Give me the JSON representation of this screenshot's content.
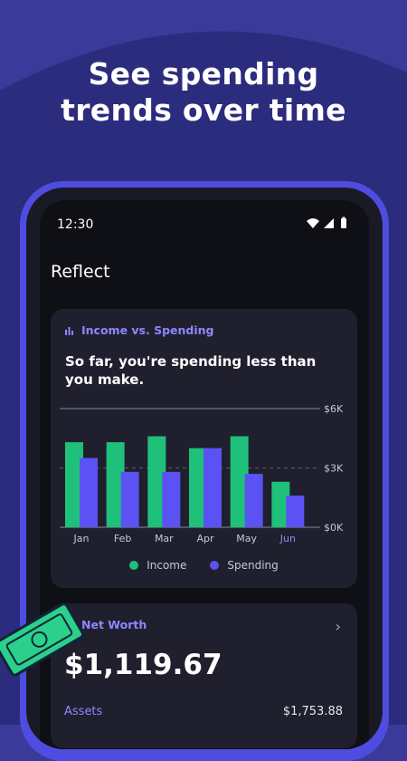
{
  "promo": {
    "headline_line1": "See spending",
    "headline_line2": "trends over time"
  },
  "status_bar": {
    "time": "12:30"
  },
  "app": {
    "title": "Reflect"
  },
  "income_vs_spending": {
    "heading": "Income vs. Spending",
    "summary": "So far, you're spending less than you make."
  },
  "chart_data": {
    "type": "bar",
    "categories": [
      "Jan",
      "Feb",
      "Mar",
      "Apr",
      "May",
      "Jun"
    ],
    "series": [
      {
        "name": "Income",
        "values": [
          4.3,
          4.3,
          4.6,
          4.0,
          4.6,
          2.3
        ]
      },
      {
        "name": "Spending",
        "values": [
          3.5,
          2.8,
          2.8,
          4.0,
          2.7,
          1.6
        ]
      }
    ],
    "ytick_labels": [
      "$0K",
      "$3K",
      "$6K"
    ],
    "ylim": [
      0,
      6
    ],
    "legend": [
      "Income",
      "Spending"
    ],
    "legend_position": "bottom",
    "highlight_category": "Jun",
    "colors": {
      "income": "#1fc07a",
      "spending": "#5a52f2",
      "highlight_label": "#8c88ff"
    }
  },
  "net_worth": {
    "heading": "Net Worth",
    "value": "$1,119.67",
    "assets_label": "Assets",
    "assets_value": "$1,753.88"
  },
  "colors": {
    "background": "#3a3a9a",
    "frame": "#4f4de0",
    "card": "#1f1f2e",
    "accent": "#8c88ff"
  },
  "icons": [
    "signal-icon",
    "wifi-icon",
    "battery-icon",
    "bar-chart-icon",
    "chevron-right-icon",
    "money-bill-icon"
  ]
}
